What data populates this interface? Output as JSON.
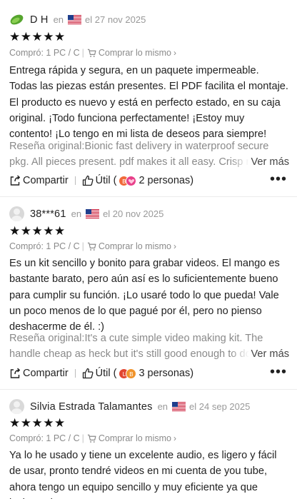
{
  "reviews": [
    {
      "name": "D H",
      "en": "en",
      "date": "el 27 nov 2025",
      "stars": "★★★★★",
      "bought": "Compró: 1 PC / C",
      "buy_same": "Comprar lo mismo",
      "body": "Entrega rápida y segura, en un paquete impermeable. Todas las piezas están presentes. El PDF facilita el montaje. El producto es nuevo y está en perfecto estado, en su caja original. ¡Todo funciona perfectamente! ¡Estoy muy contento! ¡Lo tengo en mi lista de deseos para siempre!",
      "original": "Reseña original:Bionic fast delivery in waterproof secure pkg. All pieces present. pdf makes it all easy. Crisp new pro",
      "see_more": "Ver más",
      "share": "Compartir",
      "useful": "Útil",
      "paren_open": "(",
      "persons": "2 personas)",
      "avatar_letter_1": "B",
      "avatar_letter_2": ""
    },
    {
      "name": "38***61",
      "en": "en",
      "date": "el 20 nov 2025",
      "stars": "★★★★★",
      "bought": "Compró: 1 PC / C",
      "buy_same": "Comprar lo mismo",
      "body": "Es un kit sencillo y bonito para grabar videos. El mango es bastante barato, pero aún así es lo suficientemente bueno para cumplir su función. ¡Lo usaré todo lo que pueda! Vale un poco menos de lo que pagué por él, pero no pienso deshacerme de él. :)",
      "original": "Reseña original:It's a cute simple video making kit. The handle cheap as heck but it's still good enough to do the job!",
      "see_more": "Ver más",
      "share": "Compartir",
      "useful": "Útil",
      "paren_open": "(",
      "persons": "3 personas)",
      "avatar_letter_1": "L",
      "avatar_letter_2": "B"
    },
    {
      "name": "Silvia Estrada Talamantes",
      "en": "en",
      "date": "el 24 sep 2025",
      "stars": "★★★★★",
      "bought": "Compró: 1 PC / C",
      "buy_same": "Comprar lo mismo",
      "body": "Ya lo he usado y tiene un excelente audio, es ligero y fácil de usar, pronto tendré videos en mi cuenta de you tube, ahora tengo un equipo sencillo y muy eficiente ya que incluye el"
    }
  ],
  "more_icon": "more-dots-icon",
  "colors": {
    "bubble_orange": "#f06a3a",
    "bubble_pink": "#e8408a",
    "bubble_red": "#e2452f",
    "bubble_amber": "#f0932b",
    "divider": "#ececec"
  }
}
